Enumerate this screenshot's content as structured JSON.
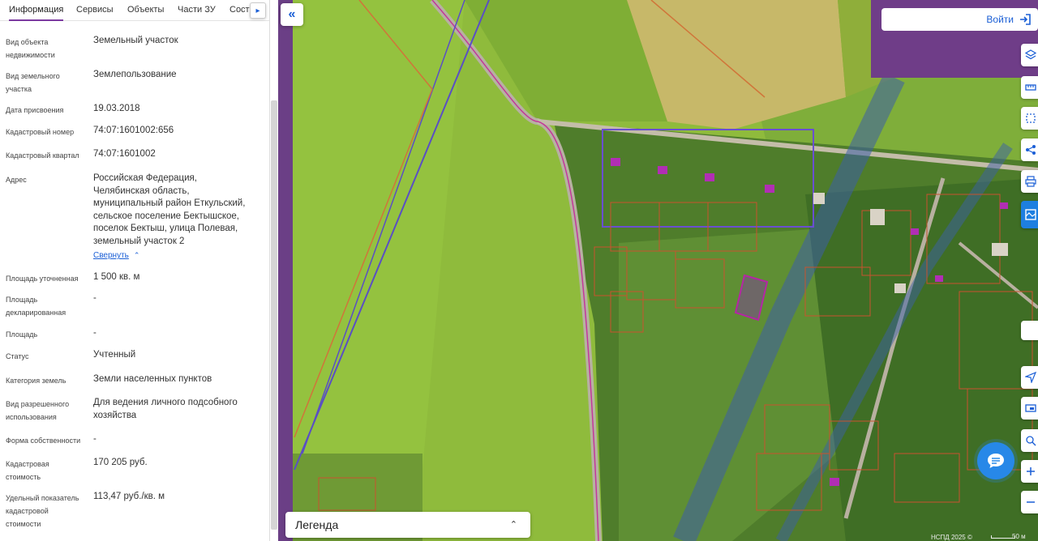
{
  "tabs": [
    "Информация",
    "Сервисы",
    "Объекты",
    "Части ЗУ",
    "Соста"
  ],
  "tab_next_icon": "chevron-right-icon",
  "fields": [
    {
      "label": "Вид объекта недвижимости",
      "value": "Земельный участок"
    },
    {
      "label": "Вид земельного участка",
      "value": "Землепользование"
    },
    {
      "label": "Дата присвоения",
      "value": "19.03.2018"
    },
    {
      "label": "Кадастровый номер",
      "value": "74:07:1601002:656"
    },
    {
      "label": "Кадастровый квартал",
      "value": "74:07:1601002"
    },
    {
      "label": "Адрес",
      "value": "Российская Федерация, Челябинская область, муниципальный район Еткульский, сельское поселение Бектышское, поселок Бектыш, улица Полевая, земельный участок 2"
    },
    {
      "label": "Площадь уточненная",
      "value": "1 500 кв. м"
    },
    {
      "label": "Площадь декларированная",
      "value": "-"
    },
    {
      "label": "Площадь",
      "value": "-"
    },
    {
      "label": "Статус",
      "value": "Учтенный"
    },
    {
      "label": "Категория земель",
      "value": "Земли населенных пунктов"
    },
    {
      "label": "Вид разрешенного использования",
      "value": "Для ведения личного подсобного хозяйства"
    },
    {
      "label": "Форма собственности",
      "value": "-"
    },
    {
      "label": "Кадастровая стоимость",
      "value": "170 205 руб."
    },
    {
      "label": "Удельный показатель кадастровой стоимости",
      "value": "113,47 руб./кв. м"
    }
  ],
  "collapse_link": "Свернуть",
  "login_label": "Войти",
  "legend_label": "Легенда",
  "attribution": "НСПД 2025 ©",
  "scale_label": "50 м",
  "colors": {
    "accent": "#6f3d88",
    "link": "#1b5fd6",
    "chat": "#2788e8"
  }
}
